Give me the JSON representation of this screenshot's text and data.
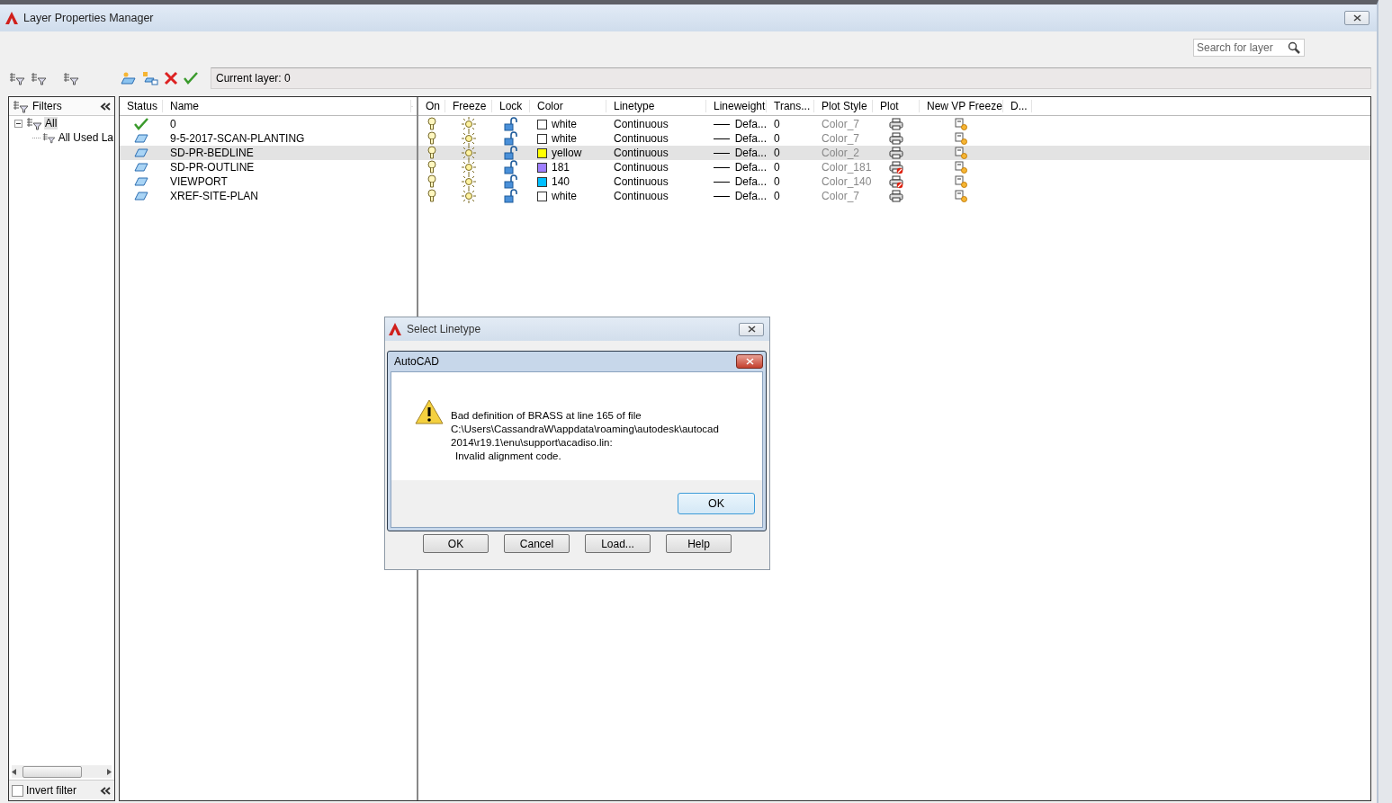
{
  "window": {
    "title": "Layer Properties Manager"
  },
  "search": {
    "placeholder": "Search for layer"
  },
  "current_layer": "Current layer: 0",
  "filters": {
    "title": "Filters",
    "tree": [
      {
        "label": "All",
        "selected": true,
        "expanded": true,
        "children": [
          {
            "label": "All Used La",
            "selected": false
          }
        ]
      }
    ],
    "invert_filter": {
      "label": "Invert filter",
      "checked": false
    }
  },
  "layers": {
    "left_columns": [
      "Status",
      "Name"
    ],
    "right_columns": [
      "On",
      "Freeze",
      "Lock",
      "Color",
      "Linetype",
      "Lineweight",
      "Trans...",
      "Plot Style",
      "Plot",
      "New VP Freeze",
      "D..."
    ],
    "rows": [
      {
        "name": "0",
        "current": true,
        "on": true,
        "frozen": false,
        "locked": false,
        "color_name": "white",
        "color": "#ffffff",
        "linetype": "Continuous",
        "lineweight": "Defa...",
        "transparency": "0",
        "plot_style": "Color_7",
        "plot": true,
        "selected": false
      },
      {
        "name": "9-5-2017-SCAN-PLANTING",
        "current": false,
        "on": true,
        "frozen": false,
        "locked": false,
        "color_name": "white",
        "color": "#ffffff",
        "linetype": "Continuous",
        "lineweight": "Defa...",
        "transparency": "0",
        "plot_style": "Color_7",
        "plot": true,
        "selected": false
      },
      {
        "name": "SD-PR-BEDLINE",
        "current": false,
        "on": true,
        "frozen": false,
        "locked": false,
        "color_name": "yellow",
        "color": "#ffff00",
        "linetype": "Continuous",
        "lineweight": "Defa...",
        "transparency": "0",
        "plot_style": "Color_2",
        "plot": true,
        "selected": true
      },
      {
        "name": "SD-PR-OUTLINE",
        "current": false,
        "on": true,
        "frozen": false,
        "locked": false,
        "color_name": "181",
        "color": "#9f7fff",
        "linetype": "Continuous",
        "lineweight": "Defa...",
        "transparency": "0",
        "plot_style": "Color_181",
        "plot": false,
        "selected": false
      },
      {
        "name": "VIEWPORT",
        "current": false,
        "on": true,
        "frozen": false,
        "locked": false,
        "color_name": "140",
        "color": "#00bfff",
        "linetype": "Continuous",
        "lineweight": "Defa...",
        "transparency": "0",
        "plot_style": "Color_140",
        "plot": false,
        "selected": false
      },
      {
        "name": "XREF-SITE-PLAN",
        "current": false,
        "on": true,
        "frozen": false,
        "locked": false,
        "color_name": "white",
        "color": "#ffffff",
        "linetype": "Continuous",
        "lineweight": "Defa...",
        "transparency": "0",
        "plot_style": "Color_7",
        "plot": true,
        "selected": false
      }
    ]
  },
  "dialog": {
    "title": "Select Linetype",
    "buttons": [
      "OK",
      "Cancel",
      "Load...",
      "Help"
    ]
  },
  "alert": {
    "title": "AutoCAD",
    "message_lines": [
      "Bad definition of BRASS at line 165 of file",
      "C:\\Users\\CassandraW\\appdata\\roaming\\autodesk\\autocad",
      "2014\\r19.1\\enu\\support\\acadiso.lin:",
      "Invalid alignment code."
    ],
    "button": "OK"
  }
}
